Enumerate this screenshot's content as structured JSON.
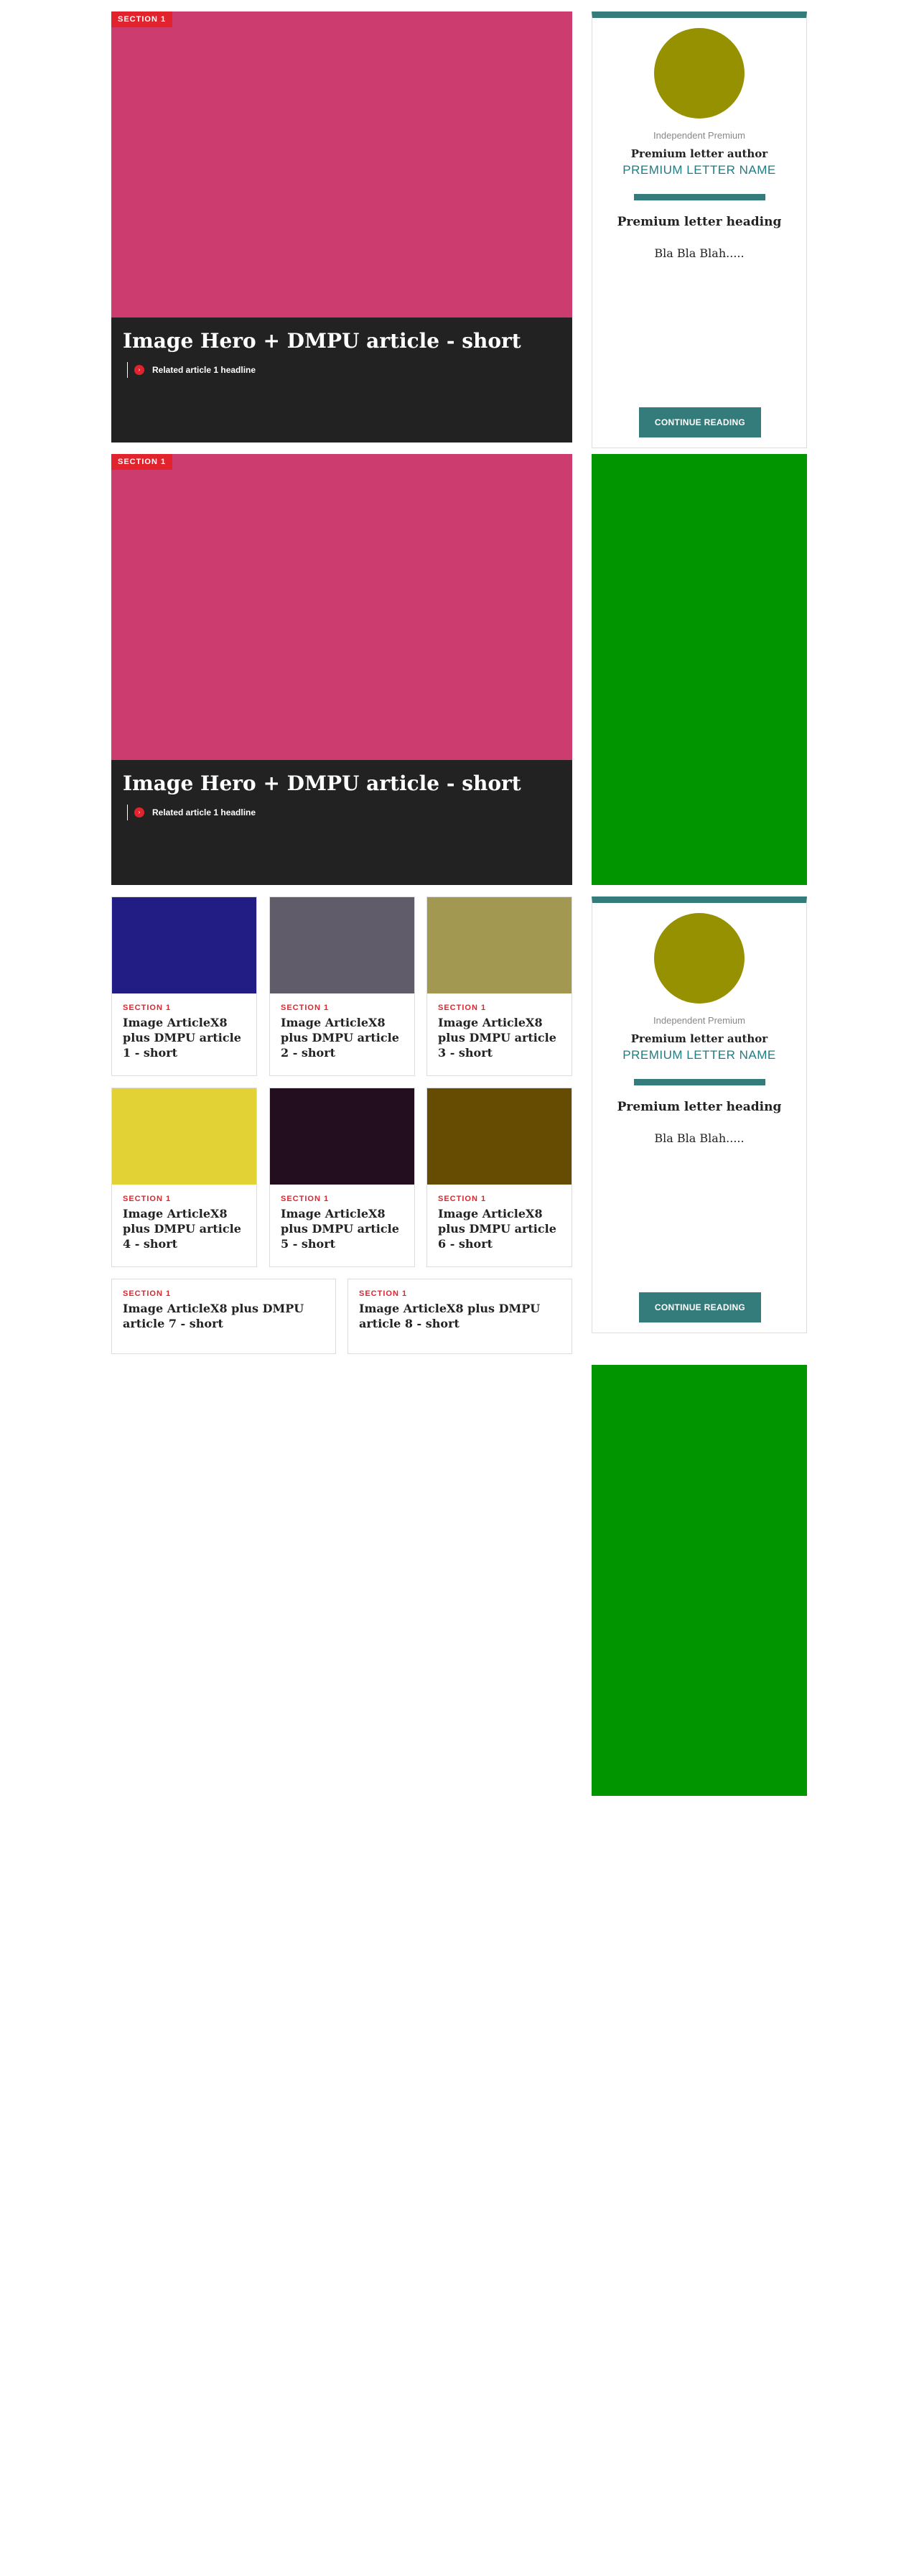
{
  "colors": {
    "section_red": "#e2232e",
    "hero_dark": "#222222",
    "premium_teal": "#347b7b",
    "premium_name": "#1f7c84",
    "avatar": "#969100",
    "ad_green": "#019600"
  },
  "heroes": [
    {
      "section": "SECTION 1",
      "image_color": "#cc3c6e",
      "title": "Image Hero + DMPU article - short",
      "related_icon": "chevron-right-icon",
      "related_icon_glyph": "›",
      "related": "Related article 1 headline"
    },
    {
      "section": "SECTION 1",
      "image_color": "#cc3c6e",
      "title": "Image Hero + DMPU article - short",
      "related_icon": "chevron-right-icon",
      "related_icon_glyph": "›",
      "related": "Related article 1 headline"
    }
  ],
  "premium_letters": [
    {
      "brand": "Independent Premium",
      "author": "Premium letter author",
      "name": "PREMIUM LETTER NAME",
      "heading": "Premium letter heading",
      "body": "Bla Bla Blah.....",
      "cta": "CONTINUE READING"
    },
    {
      "brand": "Independent Premium",
      "author": "Premium letter author",
      "name": "PREMIUM LETTER NAME",
      "heading": "Premium letter heading",
      "body": "Bla Bla Blah.....",
      "cta": "CONTINUE READING"
    }
  ],
  "articles": [
    {
      "section": "SECTION 1",
      "title": "Image ArticleX8 plus DMPU article 1 - short",
      "image_color": "#211d85"
    },
    {
      "section": "SECTION 1",
      "title": "Image ArticleX8 plus DMPU article 2 - short",
      "image_color": "#605c6a"
    },
    {
      "section": "SECTION 1",
      "title": "Image ArticleX8 plus DMPU article 3 - short",
      "image_color": "#a39852"
    },
    {
      "section": "SECTION 1",
      "title": "Image ArticleX8 plus DMPU article 4 - short",
      "image_color": "#e2d236"
    },
    {
      "section": "SECTION 1",
      "title": "Image ArticleX8 plus DMPU article 5 - short",
      "image_color": "#220e1f"
    },
    {
      "section": "SECTION 1",
      "title": "Image ArticleX8 plus DMPU article 6 - short",
      "image_color": "#664b03"
    },
    {
      "section": "SECTION 1",
      "title": "Image ArticleX8 plus DMPU article 7 - short"
    },
    {
      "section": "SECTION 1",
      "title": "Image ArticleX8 plus DMPU article 8 - short"
    }
  ]
}
